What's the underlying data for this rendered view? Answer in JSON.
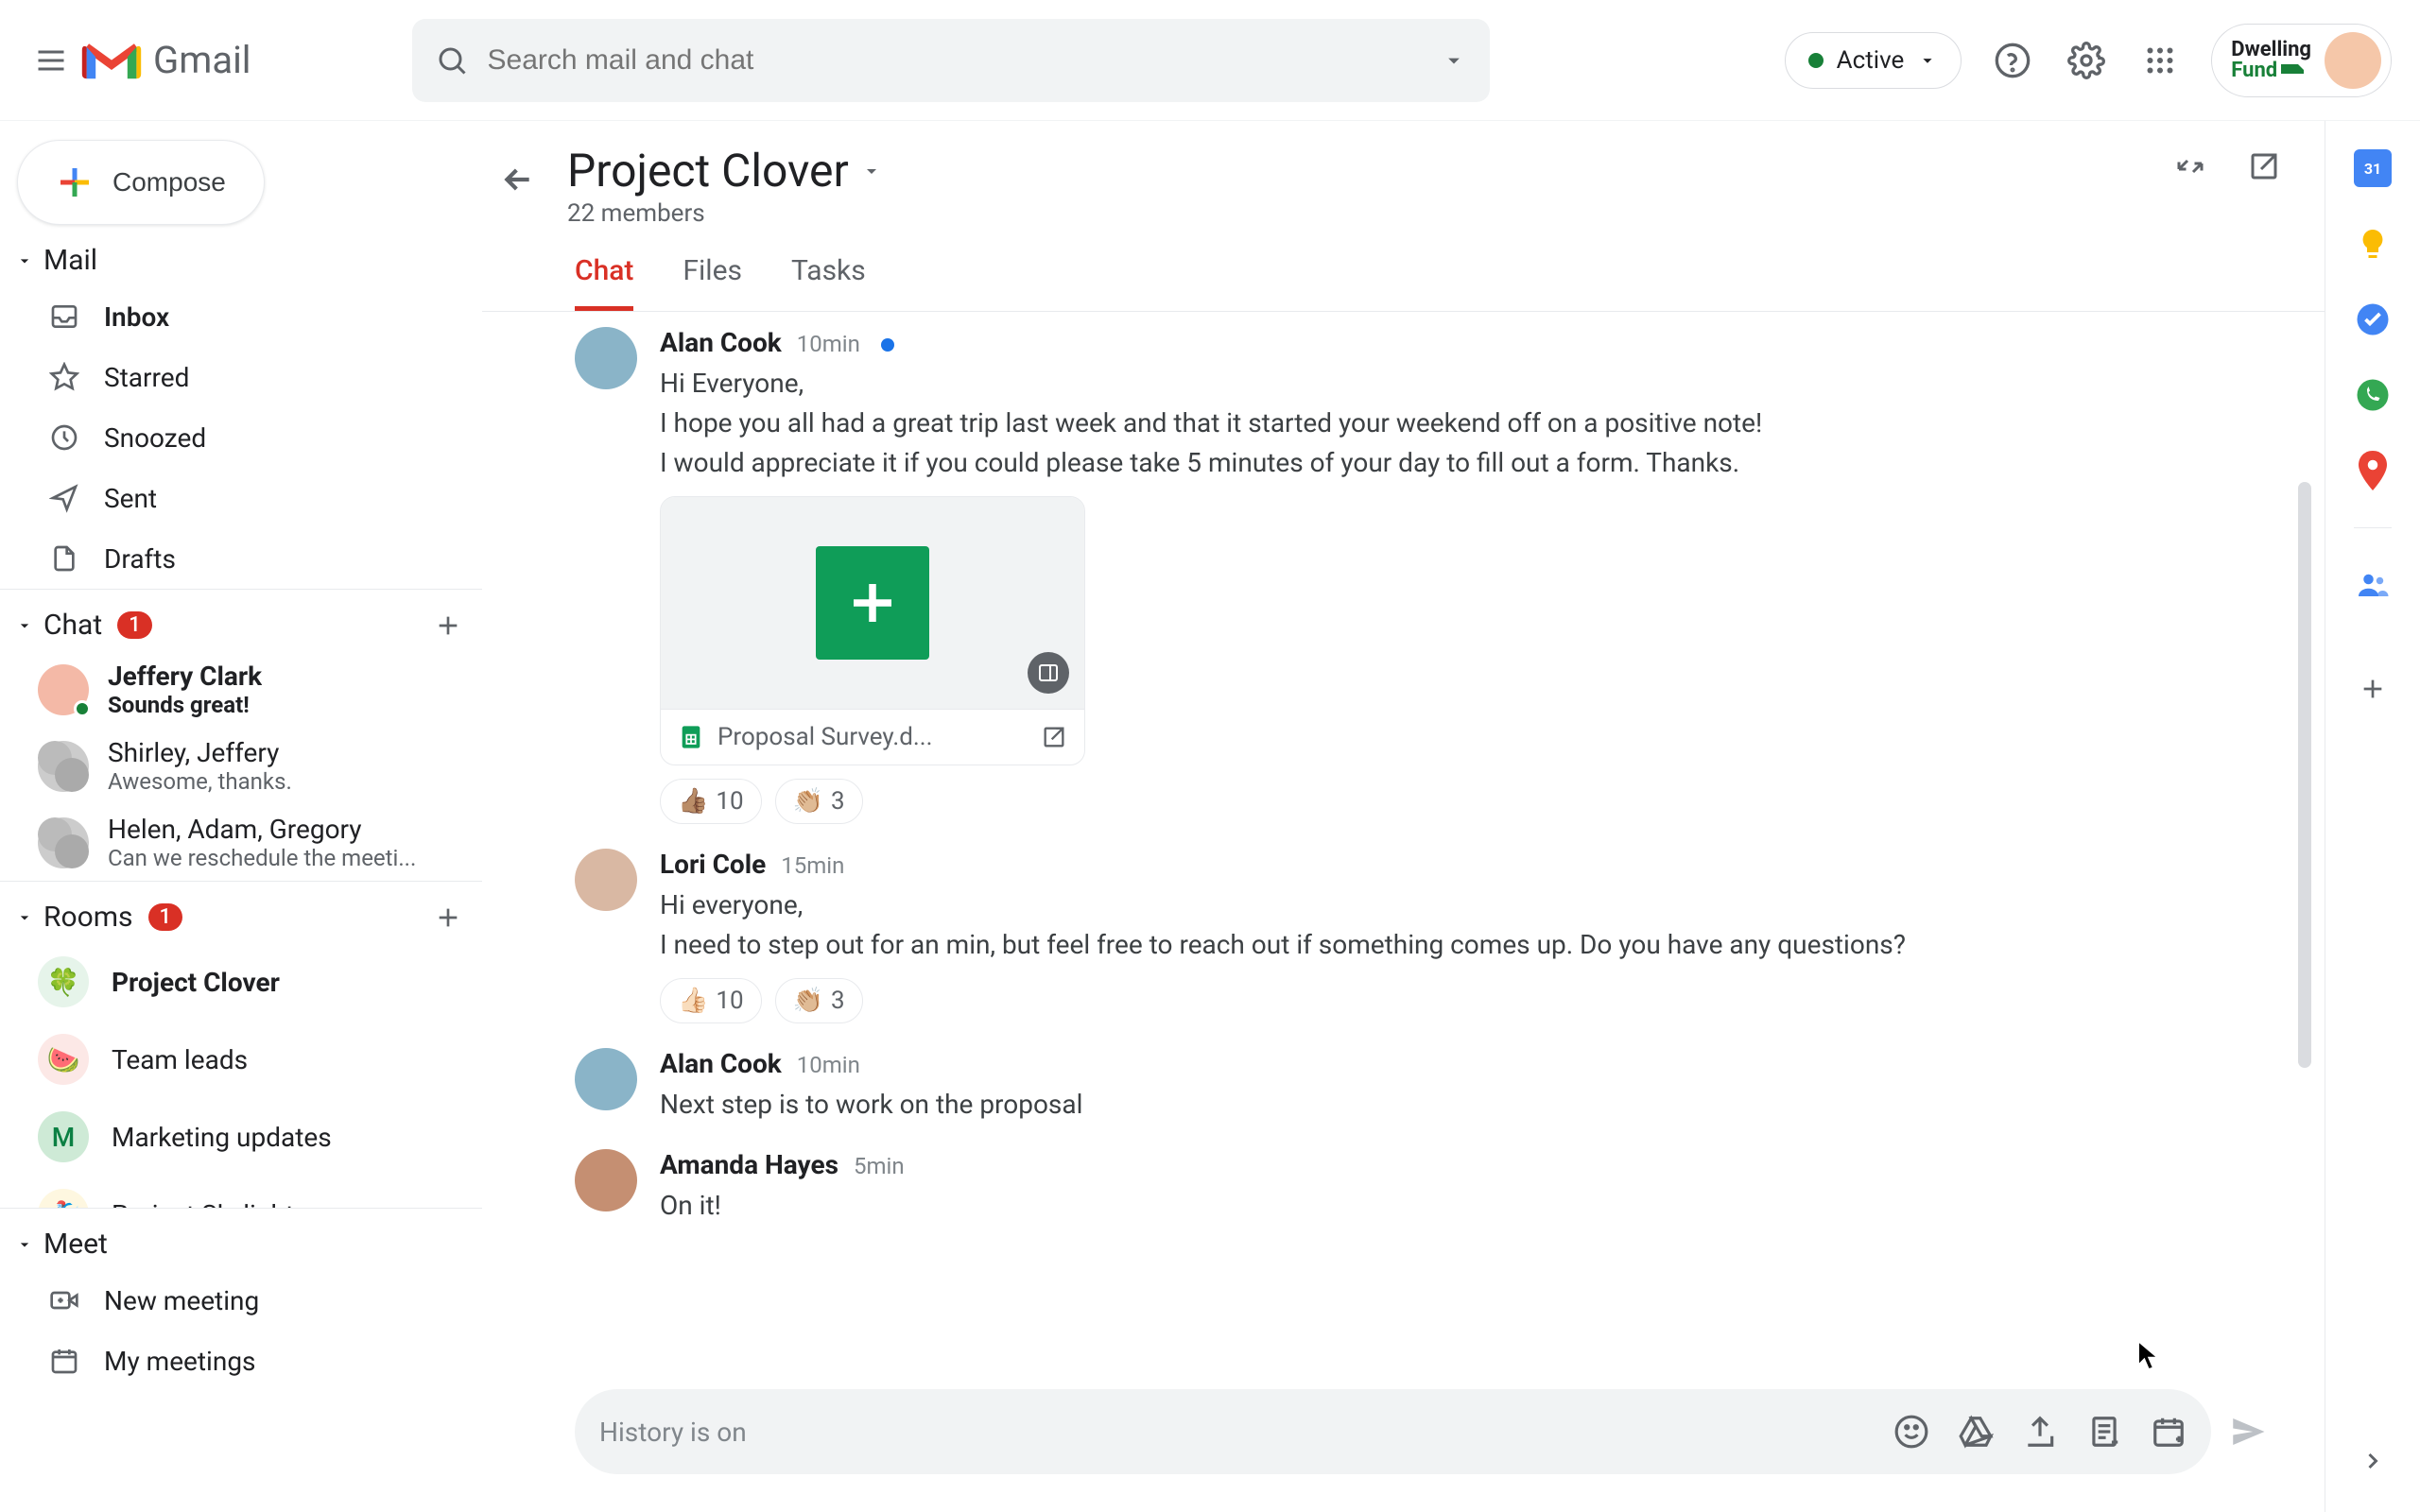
{
  "header": {
    "app_name": "Gmail",
    "search_placeholder": "Search mail and chat",
    "status_label": "Active",
    "account_brand_l1": "Dwelling",
    "account_brand_l2": "Fund"
  },
  "compose_label": "Compose",
  "sections": {
    "mail": {
      "title": "Mail",
      "items": [
        {
          "icon": "inbox",
          "label": "Inbox",
          "bold": true
        },
        {
          "icon": "star",
          "label": "Starred"
        },
        {
          "icon": "clock",
          "label": "Snoozed"
        },
        {
          "icon": "send",
          "label": "Sent"
        },
        {
          "icon": "draft",
          "label": "Drafts"
        }
      ]
    },
    "chat": {
      "title": "Chat",
      "badge": "1",
      "items": [
        {
          "name": "Jeffery Clark",
          "preview": "Sounds great!",
          "bold": true,
          "avatar": "single",
          "online": true
        },
        {
          "name": "Shirley, Jeffery",
          "preview": "Awesome, thanks.",
          "avatar": "dual"
        },
        {
          "name": "Helen, Adam, Gregory",
          "preview": "Can we reschedule the meeti...",
          "avatar": "dual"
        }
      ]
    },
    "rooms": {
      "title": "Rooms",
      "badge": "1",
      "items": [
        {
          "emoji": "🍀",
          "label": "Project Clover",
          "bold": true,
          "bg": "#e6f4ea"
        },
        {
          "emoji": "🍉",
          "label": "Team leads",
          "bg": "#fce8e6"
        },
        {
          "emoji": "",
          "label": "Marketing updates",
          "bg": "#ceead6",
          "letter": "M",
          "letter_color": "#0b8043"
        },
        {
          "emoji": "🏂",
          "label": "Project Skylight",
          "bg": "#fef7e0"
        }
      ]
    },
    "meet": {
      "title": "Meet",
      "items": [
        {
          "icon": "new-meeting",
          "label": "New meeting"
        },
        {
          "icon": "my-meetings",
          "label": "My meetings"
        }
      ]
    }
  },
  "room": {
    "title": "Project Clover",
    "subtitle": "22 members",
    "tabs": [
      "Chat",
      "Files",
      "Tasks"
    ],
    "active_tab": 0
  },
  "messages": [
    {
      "author": "Alan Cook",
      "time": "10min",
      "new": true,
      "lines": [
        "Hi Everyone,",
        "I hope you all had a great trip last week and that it started your weekend off on a positive note!",
        "I would appreciate it if you could please take 5 minutes of your day to fill out a form. Thanks."
      ],
      "attachment": {
        "name": "Proposal Survey.d..."
      },
      "reactions": [
        {
          "emoji": "👍🏽",
          "count": "10"
        },
        {
          "emoji": "👏🏼",
          "count": "3"
        }
      ]
    },
    {
      "author": "Lori Cole",
      "time": "15min",
      "lines": [
        "Hi everyone,",
        "I need to step out for an min, but feel free to reach out if something comes up.  Do you have any questions?"
      ],
      "reactions": [
        {
          "emoji": "👍🏻",
          "count": "10"
        },
        {
          "emoji": "👏🏼",
          "count": "3"
        }
      ]
    },
    {
      "author": "Alan Cook",
      "time": "10min",
      "lines": [
        "Next step is to work on the proposal"
      ]
    },
    {
      "author": "Amanda Hayes",
      "time": "5min",
      "lines": [
        "On it!"
      ]
    }
  ],
  "composer": {
    "placeholder": "History is on"
  },
  "sidepanel_apps": [
    "calendar",
    "keep",
    "tasks",
    "contacts-green",
    "maps",
    "contacts"
  ]
}
